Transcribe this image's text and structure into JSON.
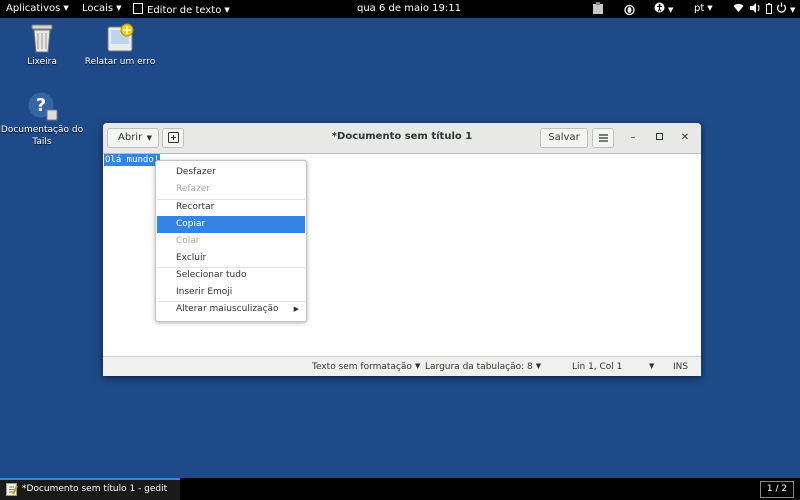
{
  "topbar": {
    "applications": "Aplicativos",
    "places": "Locais",
    "app_menu": "Editor de texto",
    "clock": "qua 6 de maio  19:11",
    "language": "pt"
  },
  "desktop": {
    "icons": [
      {
        "label": "Lixeira",
        "icon": "trash-icon"
      },
      {
        "label": "Relatar um erro",
        "icon": "bug-report-icon"
      },
      {
        "label": "Documentação do Tails",
        "icon": "help-icon"
      }
    ]
  },
  "window": {
    "open_label": "Abrir",
    "title": "*Documento sem título 1",
    "save_label": "Salvar",
    "editor_text": "Olá mundo!",
    "status": {
      "format": "Texto sem formatação",
      "tab_width": "Largura da tabulação: 8",
      "position": "Lin 1, Col 1",
      "mode": "INS"
    }
  },
  "context_menu": {
    "items": [
      {
        "label": "Desfazer",
        "enabled": true
      },
      {
        "label": "Refazer",
        "enabled": false
      },
      {
        "label": "Recortar",
        "enabled": true
      },
      {
        "label": "Copiar",
        "enabled": true,
        "highlighted": true
      },
      {
        "label": "Colar",
        "enabled": false
      },
      {
        "label": "Excluir",
        "enabled": true
      },
      {
        "label": "Selecionar tudo",
        "enabled": true
      },
      {
        "label": "Inserir Emoji",
        "enabled": true
      },
      {
        "label": "Alterar maiusculização",
        "enabled": true,
        "submenu": true
      }
    ]
  },
  "taskbar": {
    "task_label": "*Documento sem título 1 - gedit",
    "pager": "1 / 2"
  },
  "colors": {
    "desktop": "#1f4a8a",
    "accent": "#3584e4",
    "panel": "#000000"
  }
}
